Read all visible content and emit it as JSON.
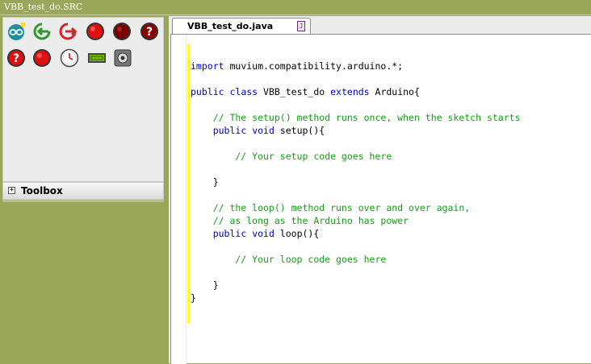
{
  "window": {
    "title": "VBB_test_do.SRC"
  },
  "toolbar": {
    "tools": [
      {
        "name": "arduino-logo-icon"
      },
      {
        "name": "import-icon"
      },
      {
        "name": "export-icon"
      },
      {
        "name": "red-button-icon"
      },
      {
        "name": "dark-red-button-icon"
      },
      {
        "name": "help-icon"
      },
      {
        "name": "help-red-icon"
      },
      {
        "name": "red-led-icon"
      },
      {
        "name": "clock-icon"
      },
      {
        "name": "lcd-icon"
      },
      {
        "name": "device-icon"
      }
    ]
  },
  "toolbox": {
    "expander": "+",
    "label": "Toolbox"
  },
  "editor": {
    "tab_label": "VBB_test_do.java",
    "tab_close": "J",
    "lines": [
      [],
      [
        {
          "t": "import",
          "c": "kw"
        },
        {
          "t": " muvium.compatibility.arduino.*;",
          "c": "tx"
        }
      ],
      [],
      [
        {
          "t": "public",
          "c": "kw"
        },
        {
          "t": " ",
          "c": "tx"
        },
        {
          "t": "class",
          "c": "kw"
        },
        {
          "t": " VBB_test_do ",
          "c": "tx"
        },
        {
          "t": "extends",
          "c": "kw"
        },
        {
          "t": " Arduino{",
          "c": "tx"
        }
      ],
      [],
      [
        {
          "t": "    // The setup() method runs once, when the sketch starts",
          "c": "cm"
        }
      ],
      [
        {
          "t": "    ",
          "c": "tx"
        },
        {
          "t": "public",
          "c": "kw"
        },
        {
          "t": " ",
          "c": "tx"
        },
        {
          "t": "void",
          "c": "kw"
        },
        {
          "t": " setup(){",
          "c": "tx"
        }
      ],
      [],
      [
        {
          "t": "        // Your setup code goes here",
          "c": "cm"
        }
      ],
      [],
      [
        {
          "t": "    }",
          "c": "tx"
        }
      ],
      [],
      [
        {
          "t": "    // the loop() method runs over and over again,",
          "c": "cm"
        }
      ],
      [
        {
          "t": "    // as long as the Arduino has power",
          "c": "cm"
        }
      ],
      [
        {
          "t": "    ",
          "c": "tx"
        },
        {
          "t": "public",
          "c": "kw"
        },
        {
          "t": " ",
          "c": "tx"
        },
        {
          "t": "void",
          "c": "kw"
        },
        {
          "t": " loop(){",
          "c": "tx"
        }
      ],
      [],
      [
        {
          "t": "        // Your loop code goes here",
          "c": "cm"
        }
      ],
      [],
      [
        {
          "t": "    }",
          "c": "tx"
        }
      ],
      [
        {
          "t": "}",
          "c": "tx"
        }
      ]
    ]
  },
  "colors": {
    "background": "#9aa65a",
    "keyword": "#0000c0",
    "comment": "#1a9a1a",
    "marker": "#ffff33"
  }
}
